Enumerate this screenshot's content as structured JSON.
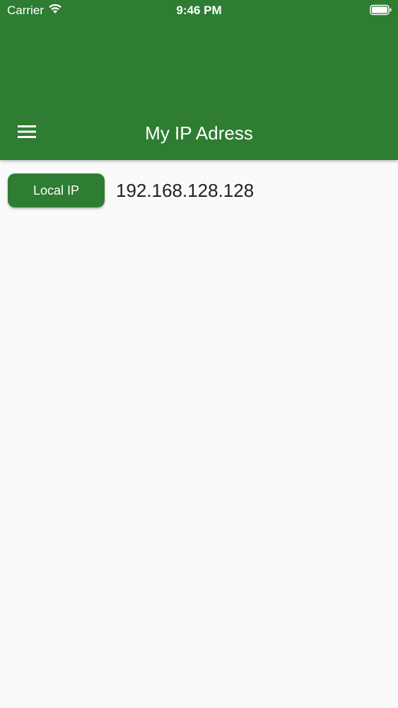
{
  "status_bar": {
    "carrier": "Carrier",
    "time": "9:46 PM"
  },
  "app_bar": {
    "title": "My IP Adress",
    "color": "#2e7d32",
    "menu_icon": "hamburger-menu-icon"
  },
  "main": {
    "local_ip_button_label": "Local IP",
    "ip_value": "192.168.128.128"
  }
}
